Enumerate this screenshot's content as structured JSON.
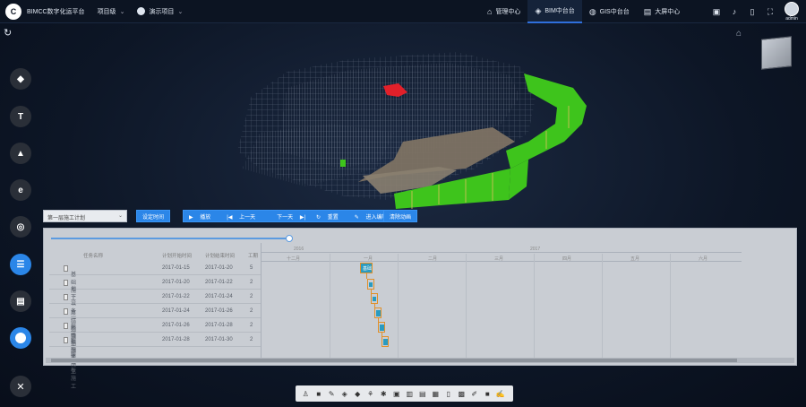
{
  "app": {
    "title": "BIMCC数字化运平台",
    "logo_text": "C"
  },
  "header": {
    "org_selector": "项目级",
    "project_selector": "演示项目",
    "nav": [
      {
        "label": "管理中心",
        "icon": "⌂"
      },
      {
        "label": "BIM中台台",
        "icon": "◈",
        "active": true
      },
      {
        "label": "GIS中台台",
        "icon": "◍"
      },
      {
        "label": "大屏中心",
        "icon": "▤"
      }
    ],
    "user_name": "admin"
  },
  "gantt": {
    "plan_select": "第一层施工计划",
    "set_time_label": "设定时间",
    "controls": {
      "play": "播放",
      "prev": "上一天",
      "next": "下一天",
      "reset": "重置",
      "edit_mode": "进入编辑模式"
    },
    "clear_label": "清除动画",
    "columns": [
      "任务名称",
      "计划开始时间",
      "计划结束时间",
      "工期"
    ],
    "rows": [
      {
        "name": "基础施工",
        "start": "2017-01-15",
        "end": "2017-01-20",
        "duration": "5"
      },
      {
        "name": "地下一层结构施工",
        "start": "2017-01-20",
        "end": "2017-01-22",
        "duration": "2"
      },
      {
        "name": "设备一层结构施工",
        "start": "2017-01-22",
        "end": "2017-01-24",
        "duration": "2"
      },
      {
        "name": "一层梁板施工",
        "start": "2017-01-24",
        "end": "2017-01-26",
        "duration": "2"
      },
      {
        "name": "一层墙体施工",
        "start": "2017-01-26",
        "end": "2017-01-28",
        "duration": "2"
      },
      {
        "name": "一层梁板施工",
        "start": "2017-01-28",
        "end": "2017-01-30",
        "duration": "2"
      }
    ],
    "timeline": {
      "years": [
        "2016",
        "2017"
      ],
      "months": [
        "十二月",
        "一月",
        "二月",
        "三月",
        "四月",
        "五月",
        "六月"
      ],
      "first_bar_label": "基础"
    }
  },
  "colors": {
    "accent": "#2b86e8",
    "bar_fill": "#2a9bc0",
    "bar_border": "#e0902a",
    "model_green": "#3ec41c"
  }
}
